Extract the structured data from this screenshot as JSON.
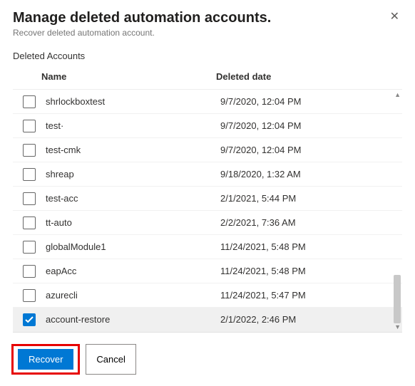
{
  "header": {
    "title": "Manage deleted automation accounts.",
    "subtitle": "Recover deleted automation account."
  },
  "section_label": "Deleted Accounts",
  "columns": {
    "name": "Name",
    "date": "Deleted date"
  },
  "rows": [
    {
      "name": "shrlockboxtest",
      "date": "9/7/2020, 12:04 PM",
      "checked": false
    },
    {
      "name": "test·",
      "date": "9/7/2020, 12:04 PM",
      "checked": false
    },
    {
      "name": "test-cmk",
      "date": "9/7/2020, 12:04 PM",
      "checked": false
    },
    {
      "name": "shreap",
      "date": "9/18/2020, 1:32 AM",
      "checked": false
    },
    {
      "name": "test-acc",
      "date": "2/1/2021, 5:44 PM",
      "checked": false
    },
    {
      "name": "tt-auto",
      "date": "2/2/2021, 7:36 AM",
      "checked": false
    },
    {
      "name": "globalModule1",
      "date": "11/24/2021, 5:48 PM",
      "checked": false
    },
    {
      "name": "eapAcc",
      "date": "11/24/2021, 5:48 PM",
      "checked": false
    },
    {
      "name": "azurecli",
      "date": "11/24/2021, 5:47 PM",
      "checked": false
    },
    {
      "name": "account-restore",
      "date": "2/1/2022, 2:46 PM",
      "checked": true
    }
  ],
  "buttons": {
    "recover": "Recover",
    "cancel": "Cancel"
  },
  "colors": {
    "primary": "#0078d4",
    "highlight": "#e60000"
  }
}
